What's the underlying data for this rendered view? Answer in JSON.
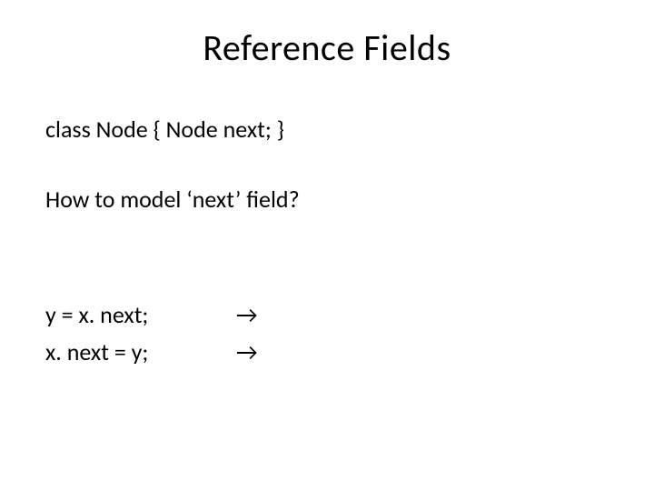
{
  "slide": {
    "title": "Reference Fields",
    "class_declaration": "class Node { Node next; }",
    "question": "How to model ‘next’ field?",
    "rows": [
      {
        "code": "y = x. next;",
        "arrow": "→"
      },
      {
        "code": "x. next = y;",
        "arrow": "→"
      }
    ]
  }
}
